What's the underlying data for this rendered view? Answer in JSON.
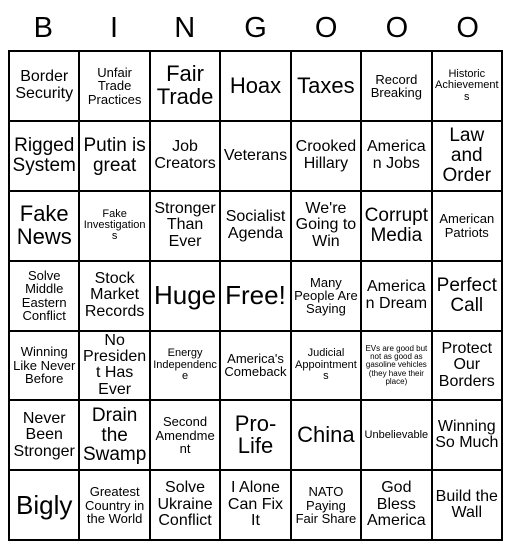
{
  "card": {
    "title": "BINGO Card",
    "columns": 7,
    "rows": 7,
    "border_color": "#000000",
    "background_color": "#ffffff",
    "text_color": "#000000",
    "header": {
      "letters": [
        "B",
        "I",
        "N",
        "G",
        "O",
        "O",
        "O"
      ]
    },
    "cells": [
      [
        {
          "text": "Border Security",
          "size": "m"
        },
        {
          "text": "Unfair Trade Practices",
          "size": "s"
        },
        {
          "text": "Fair Trade",
          "size": "xl"
        },
        {
          "text": "Hoax",
          "size": "xl"
        },
        {
          "text": "Taxes",
          "size": "xl"
        },
        {
          "text": "Record Breaking",
          "size": "s"
        },
        {
          "text": "Historic Achievements",
          "size": "xs"
        }
      ],
      [
        {
          "text": "Rigged System",
          "size": "l"
        },
        {
          "text": "Putin is great",
          "size": "l"
        },
        {
          "text": "Job Creators",
          "size": "m"
        },
        {
          "text": "Veterans",
          "size": "m"
        },
        {
          "text": "Crooked Hillary",
          "size": "m"
        },
        {
          "text": "American Jobs",
          "size": "m"
        },
        {
          "text": "Law and Order",
          "size": "l"
        }
      ],
      [
        {
          "text": "Fake News",
          "size": "xl"
        },
        {
          "text": "Fake Investigations",
          "size": "xs"
        },
        {
          "text": "Stronger Than Ever",
          "size": "m"
        },
        {
          "text": "Socialist Agenda",
          "size": "m"
        },
        {
          "text": "We're Going to Win",
          "size": "m"
        },
        {
          "text": "Corrupt Media",
          "size": "l"
        },
        {
          "text": "American Patriots",
          "size": "s"
        }
      ],
      [
        {
          "text": "Solve Middle Eastern Conflict",
          "size": "s"
        },
        {
          "text": "Stock Market Records",
          "size": "m"
        },
        {
          "text": "Huge",
          "size": "xxl"
        },
        {
          "text": "Free!",
          "size": "xxl"
        },
        {
          "text": "Many People Are Saying",
          "size": "s"
        },
        {
          "text": "American Dream",
          "size": "m"
        },
        {
          "text": "Perfect Call",
          "size": "l"
        }
      ],
      [
        {
          "text": "Winning Like Never Before",
          "size": "s"
        },
        {
          "text": "No President Has Ever",
          "size": "m"
        },
        {
          "text": "Energy Independence",
          "size": "xs"
        },
        {
          "text": "America's Comeback",
          "size": "s"
        },
        {
          "text": "Judicial Appointments",
          "size": "xs"
        },
        {
          "text": "Protect Our Borders",
          "size": "m"
        },
        {
          "text": "",
          "size": "m"
        }
      ],
      [
        {
          "text": "Never Been Stronger",
          "size": "m"
        },
        {
          "text": "Drain the Swamp",
          "size": "l"
        },
        {
          "text": "Second Amendment",
          "size": "s"
        },
        {
          "text": "Pro-Life",
          "size": "xl"
        },
        {
          "text": "China",
          "size": "xl"
        },
        {
          "text": "Unbelievable",
          "size": "xs"
        },
        {
          "text": "Winning So Much",
          "size": "m"
        }
      ],
      [
        {
          "text": "Bigly",
          "size": "xxl"
        },
        {
          "text": "Greatest Country in the World",
          "size": "s"
        },
        {
          "text": "Solve Ukraine Conflict",
          "size": "m"
        },
        {
          "text": "I Alone Can Fix It",
          "size": "m"
        },
        {
          "text": "NATO Paying Fair Share",
          "size": "s"
        },
        {
          "text": "God Bless America",
          "size": "m"
        },
        {
          "text": "Build the Wall",
          "size": "m"
        }
      ]
    ],
    "special_cells": {
      "evs": {
        "row": 4,
        "col": 5,
        "text": "EVs are good but not as good as gasoline vehicles (they have their place)",
        "size": "xxs"
      }
    }
  }
}
